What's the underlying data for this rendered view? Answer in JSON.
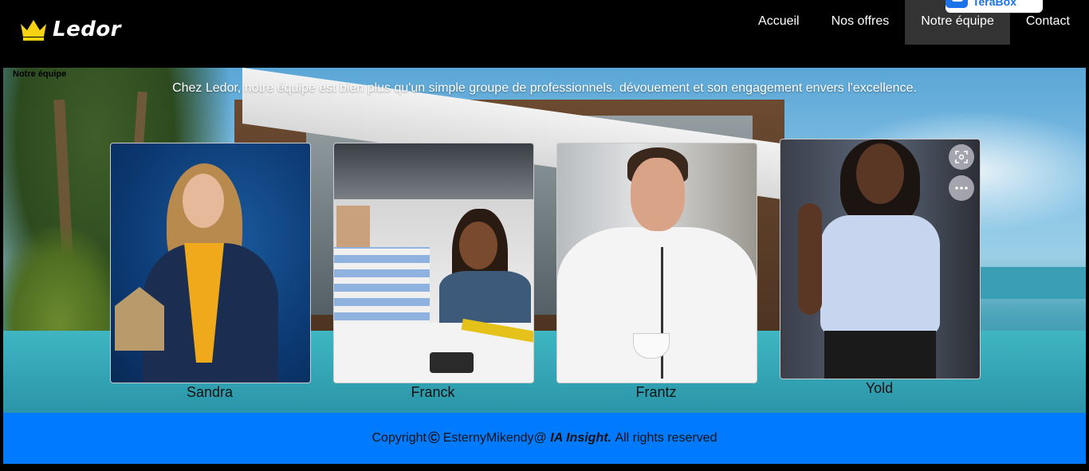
{
  "header": {
    "brand": "Ledor",
    "nav": [
      {
        "label": "Accueil",
        "active": false
      },
      {
        "label": "Nos offres",
        "active": false
      },
      {
        "label": "Notre équipe",
        "active": true
      },
      {
        "label": "Contact",
        "active": false
      }
    ],
    "extension_badge": "TeraBox",
    "colors": {
      "background": "#000000",
      "active_item": "#333333",
      "crown": "#f5d313"
    }
  },
  "hero": {
    "section_label": "Notre équipe",
    "intro": "Chez Ledor, notre équipe est bien plus qu'un simple groupe de professionnels. dévouement et son engagement envers l'excellence.",
    "members": [
      {
        "name": "Sandra"
      },
      {
        "name": "Franck"
      },
      {
        "name": "Frantz"
      },
      {
        "name": "Yold"
      }
    ],
    "image_overlay_icons": [
      "screenshot-icon",
      "more-options-icon"
    ]
  },
  "footer": {
    "prefix": "Copyright",
    "symbol": "©",
    "author": "EsternyMikendy@",
    "company": "IA Insight.",
    "rights": "All rights reserved",
    "color": "#007bff"
  }
}
